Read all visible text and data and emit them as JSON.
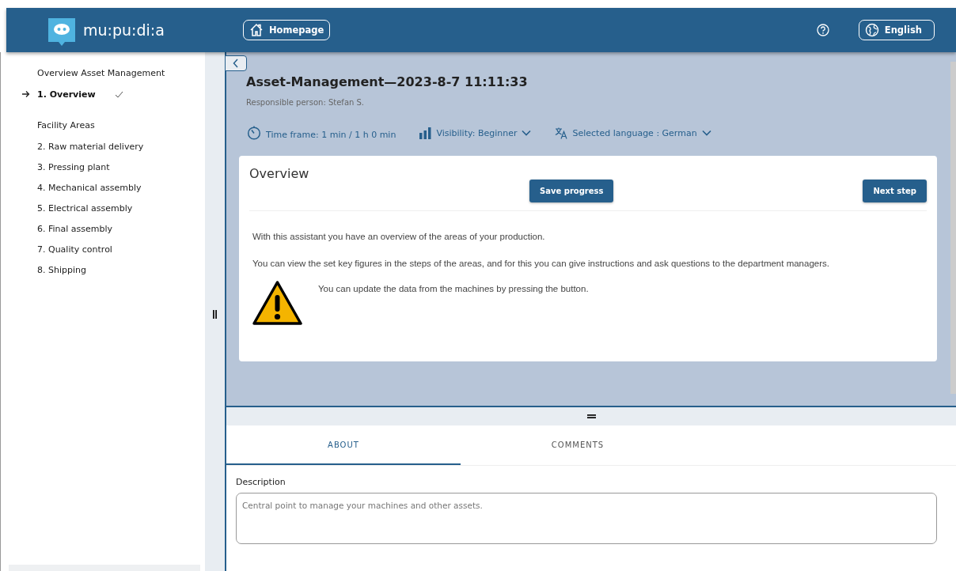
{
  "header": {
    "logo_text": "mu:pu:di:a",
    "home_button": "Homepage",
    "language_button": "English"
  },
  "sidebar": {
    "sections": [
      {
        "heading": "Overview Asset Management",
        "items": [
          {
            "label": "1. Overview",
            "selected": true,
            "completed": true
          }
        ]
      },
      {
        "heading": "Facility Areas",
        "items": [
          {
            "label": "2. Raw material delivery",
            "selected": false,
            "completed": false
          },
          {
            "label": "3. Pressing plant",
            "selected": false,
            "completed": false
          },
          {
            "label": "4. Mechanical assembly",
            "selected": false,
            "completed": false
          },
          {
            "label": "5. Electrical assembly",
            "selected": false,
            "completed": false
          },
          {
            "label": "6. Final assembly",
            "selected": false,
            "completed": false
          },
          {
            "label": "7. Quality control",
            "selected": false,
            "completed": false
          },
          {
            "label": "8. Shipping",
            "selected": false,
            "completed": false
          }
        ]
      }
    ]
  },
  "process": {
    "title": "Asset-Management—2023-8-7 11:11:33",
    "responsible": "Responsible person: Stefan S.",
    "meta": [
      {
        "kind": "time",
        "text": "Time frame: 1 min / 1 h 0 min"
      },
      {
        "kind": "visibility",
        "text": "Visibility: Beginner"
      },
      {
        "kind": "language",
        "text": "Selected language : German"
      }
    ]
  },
  "step": {
    "title": "Overview",
    "save_button": "Save progress",
    "next_button": "Next step",
    "paragraphs": [
      {
        "kind": "text",
        "text": "With this assistant you have an overview of the areas of your production."
      },
      {
        "kind": "text",
        "text": "You can view the set key figures in the steps of the areas, and for this you can give instructions and ask questions to the department managers."
      },
      {
        "kind": "warning",
        "text": "You can update the data from the machines by pressing the button."
      }
    ]
  },
  "tabs": [
    {
      "label": "ABOUT",
      "selected": true
    },
    {
      "label": "COMMENTS",
      "selected": false
    }
  ],
  "description": {
    "label": "Description",
    "value": "Central point to manage your machines and other assets."
  }
}
